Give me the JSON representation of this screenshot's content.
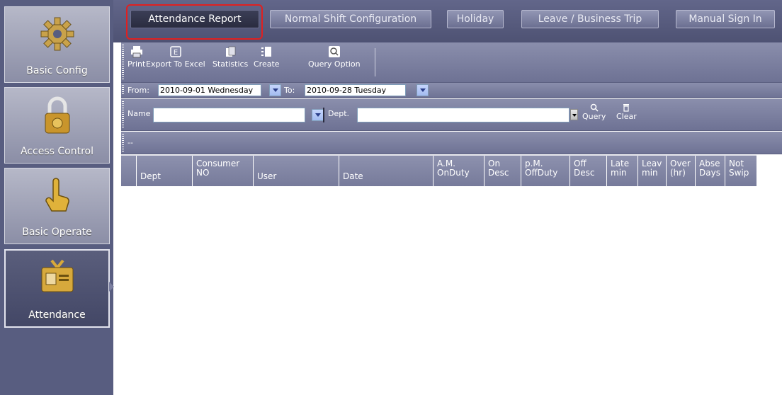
{
  "sidebar": {
    "items": [
      {
        "label": "Basic Config",
        "icon": "gear-icon"
      },
      {
        "label": "Access Control",
        "icon": "padlock-icon"
      },
      {
        "label": "Basic Operate",
        "icon": "hand-pointer-icon"
      },
      {
        "label": "Attendance",
        "icon": "id-badge-icon",
        "active": true
      }
    ]
  },
  "tabs": [
    {
      "label": "Attendance Report",
      "active": true
    },
    {
      "label": "Normal Shift Configuration"
    },
    {
      "label": "Holiday"
    },
    {
      "label": "Leave / Business Trip"
    },
    {
      "label": "Manual Sign In"
    }
  ],
  "toolbar": {
    "print": "Print",
    "export": "Export To Excel",
    "statistics": "Statistics",
    "create": "Create",
    "query_option": "Query Option"
  },
  "date_filter": {
    "from_label": "From:",
    "from_value": "2010-09-01 Wednesday",
    "to_label": "To:",
    "to_value": "2010-09-28   Tuesday"
  },
  "search": {
    "name_label": "Name",
    "name_value": "",
    "dept_label": "Dept.",
    "dept_value": "",
    "query": "Query",
    "clear": "Clear"
  },
  "status": {
    "text": "--"
  },
  "grid": {
    "columns": [
      {
        "l1": "Dept",
        "l2": ""
      },
      {
        "l1": "Consumer",
        "l2": "NO"
      },
      {
        "l1": "User",
        "l2": ""
      },
      {
        "l1": "Date",
        "l2": ""
      },
      {
        "l1": "A.M.",
        "l2": "OnDuty"
      },
      {
        "l1": "On",
        "l2": "Desc"
      },
      {
        "l1": "p.M.",
        "l2": "OffDuty"
      },
      {
        "l1": "Off",
        "l2": "Desc"
      },
      {
        "l1": "Late",
        "l2": "min"
      },
      {
        "l1": "Leav",
        "l2": "min"
      },
      {
        "l1": "Over",
        "l2": "(hr)"
      },
      {
        "l1": "Abse",
        "l2": "Days"
      },
      {
        "l1": "Not",
        "l2": "Swip"
      }
    ]
  },
  "colors": {
    "sidebar_bg": "#585d80",
    "active_highlight": "#e02020",
    "header_bg": "#767a9a"
  }
}
